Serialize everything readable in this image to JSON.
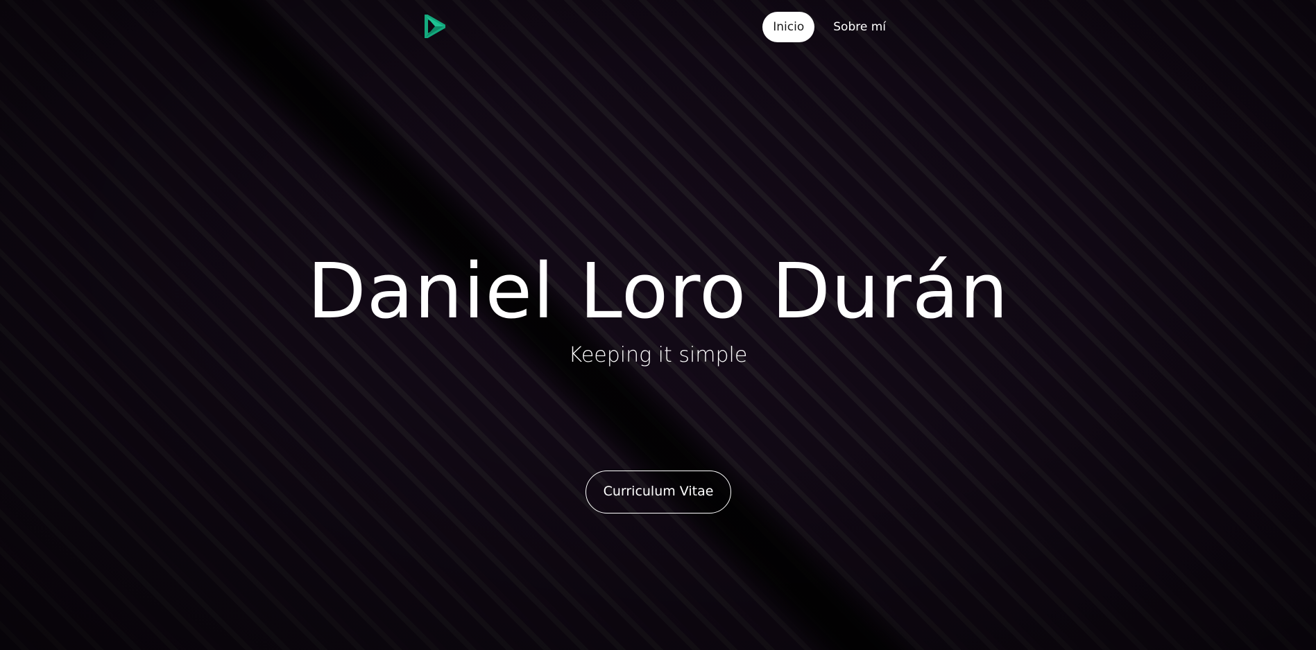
{
  "nav": {
    "logo_icon": "play-triangle-logo-icon",
    "logo_color": "#14a97e",
    "links": [
      {
        "label": "Inicio",
        "active": true
      },
      {
        "label": "Sobre mí",
        "active": false
      }
    ]
  },
  "hero": {
    "title": "Daniel Loro Durán",
    "subtitle": "Keeping it simple",
    "cta_label": "Curriculum Vitae"
  },
  "colors": {
    "background": "#0f0812",
    "stripe": "#201a22",
    "text": "#ffffff",
    "active_pill_bg": "#ffffff"
  }
}
